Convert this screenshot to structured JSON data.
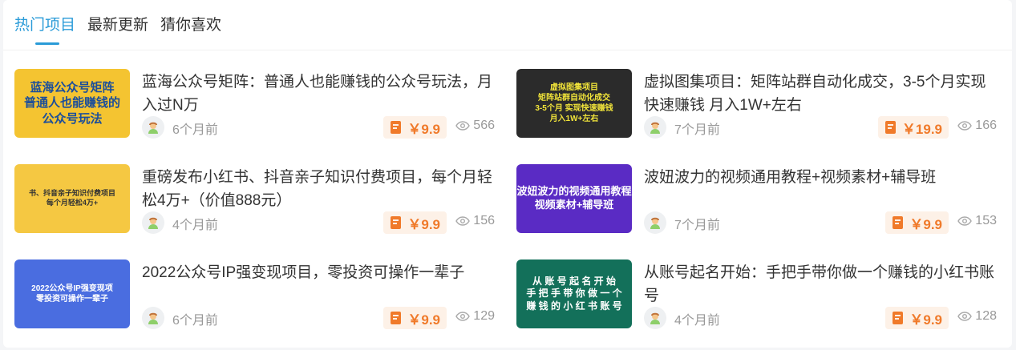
{
  "tabs": [
    {
      "label": "热门项目"
    },
    {
      "label": "最新更新"
    },
    {
      "label": "猜你喜欢"
    }
  ],
  "colors": {
    "accent": "#2a9bd8",
    "price": "#f07a2a"
  },
  "items": [
    {
      "title": "蓝海公众号矩阵：普通人也能赚钱的公众号玩法，月入过N万",
      "time": "6个月前",
      "price": "￥9.9",
      "views": "566",
      "thumb": {
        "text": "蓝海公众号矩阵\n普通人也能赚钱的\n公众号玩法",
        "bg": "#f4c431",
        "fg": "#1b4e9b"
      }
    },
    {
      "title": "虚拟图集项目：矩阵站群自动化成交，3-5个月实现快速赚钱 月入1W+左右",
      "time": "7个月前",
      "price": "￥19.9",
      "views": "166",
      "thumb": {
        "text": "虚拟图集项目\n矩阵站群自动化成交\n3-5个月 实现快速赚钱\n月入1W+左右",
        "bg": "#2b2b2b",
        "fg": "#f2e53a"
      }
    },
    {
      "title": "重磅发布小红书、抖音亲子知识付费项目，每个月轻松4万+（价值888元）",
      "time": "4个月前",
      "price": "￥9.9",
      "views": "156",
      "thumb": {
        "text": "书、抖音亲子知识付费项目\n每个月轻松4万+",
        "bg": "#f5c842",
        "fg": "#333333"
      }
    },
    {
      "title": "波妞波力的视频通用教程+视频素材+辅导班",
      "time": "7个月前",
      "price": "￥9.9",
      "views": "153",
      "thumb": {
        "text": "波妞波力的视频通用教程\n视频素材+辅导班",
        "bg": "#5a2bc4",
        "fg": "#ffffff"
      }
    },
    {
      "title": "2022公众号IP强变现项目，零投资可操作一辈子",
      "time": "6个月前",
      "price": "￥9.9",
      "views": "129",
      "thumb": {
        "text": "2022公众号IP强变现项\n零投资可操作一辈子",
        "bg": "#4a6de0",
        "fg": "#ffffff"
      }
    },
    {
      "title": "从账号起名开始：手把手带你做一个赚钱的小红书账号",
      "time": "4个月前",
      "price": "￥9.9",
      "views": "128",
      "thumb": {
        "text": "从 账 号 起 名 开 始\n手 把 手 带 你 做 一 个\n赚 钱 的 小 红 书 账 号",
        "bg": "#13705a",
        "fg": "#ffffff"
      }
    }
  ]
}
